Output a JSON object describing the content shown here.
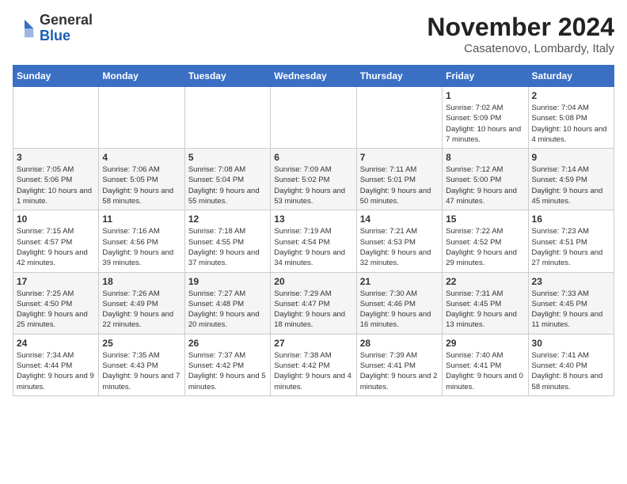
{
  "header": {
    "logo_general": "General",
    "logo_blue": "Blue",
    "month_title": "November 2024",
    "location": "Casatenovo, Lombardy, Italy"
  },
  "weekdays": [
    "Sunday",
    "Monday",
    "Tuesday",
    "Wednesday",
    "Thursday",
    "Friday",
    "Saturday"
  ],
  "weeks": [
    [
      {
        "day": "",
        "info": ""
      },
      {
        "day": "",
        "info": ""
      },
      {
        "day": "",
        "info": ""
      },
      {
        "day": "",
        "info": ""
      },
      {
        "day": "",
        "info": ""
      },
      {
        "day": "1",
        "info": "Sunrise: 7:02 AM\nSunset: 5:09 PM\nDaylight: 10 hours and 7 minutes."
      },
      {
        "day": "2",
        "info": "Sunrise: 7:04 AM\nSunset: 5:08 PM\nDaylight: 10 hours and 4 minutes."
      }
    ],
    [
      {
        "day": "3",
        "info": "Sunrise: 7:05 AM\nSunset: 5:06 PM\nDaylight: 10 hours and 1 minute."
      },
      {
        "day": "4",
        "info": "Sunrise: 7:06 AM\nSunset: 5:05 PM\nDaylight: 9 hours and 58 minutes."
      },
      {
        "day": "5",
        "info": "Sunrise: 7:08 AM\nSunset: 5:04 PM\nDaylight: 9 hours and 55 minutes."
      },
      {
        "day": "6",
        "info": "Sunrise: 7:09 AM\nSunset: 5:02 PM\nDaylight: 9 hours and 53 minutes."
      },
      {
        "day": "7",
        "info": "Sunrise: 7:11 AM\nSunset: 5:01 PM\nDaylight: 9 hours and 50 minutes."
      },
      {
        "day": "8",
        "info": "Sunrise: 7:12 AM\nSunset: 5:00 PM\nDaylight: 9 hours and 47 minutes."
      },
      {
        "day": "9",
        "info": "Sunrise: 7:14 AM\nSunset: 4:59 PM\nDaylight: 9 hours and 45 minutes."
      }
    ],
    [
      {
        "day": "10",
        "info": "Sunrise: 7:15 AM\nSunset: 4:57 PM\nDaylight: 9 hours and 42 minutes."
      },
      {
        "day": "11",
        "info": "Sunrise: 7:16 AM\nSunset: 4:56 PM\nDaylight: 9 hours and 39 minutes."
      },
      {
        "day": "12",
        "info": "Sunrise: 7:18 AM\nSunset: 4:55 PM\nDaylight: 9 hours and 37 minutes."
      },
      {
        "day": "13",
        "info": "Sunrise: 7:19 AM\nSunset: 4:54 PM\nDaylight: 9 hours and 34 minutes."
      },
      {
        "day": "14",
        "info": "Sunrise: 7:21 AM\nSunset: 4:53 PM\nDaylight: 9 hours and 32 minutes."
      },
      {
        "day": "15",
        "info": "Sunrise: 7:22 AM\nSunset: 4:52 PM\nDaylight: 9 hours and 29 minutes."
      },
      {
        "day": "16",
        "info": "Sunrise: 7:23 AM\nSunset: 4:51 PM\nDaylight: 9 hours and 27 minutes."
      }
    ],
    [
      {
        "day": "17",
        "info": "Sunrise: 7:25 AM\nSunset: 4:50 PM\nDaylight: 9 hours and 25 minutes."
      },
      {
        "day": "18",
        "info": "Sunrise: 7:26 AM\nSunset: 4:49 PM\nDaylight: 9 hours and 22 minutes."
      },
      {
        "day": "19",
        "info": "Sunrise: 7:27 AM\nSunset: 4:48 PM\nDaylight: 9 hours and 20 minutes."
      },
      {
        "day": "20",
        "info": "Sunrise: 7:29 AM\nSunset: 4:47 PM\nDaylight: 9 hours and 18 minutes."
      },
      {
        "day": "21",
        "info": "Sunrise: 7:30 AM\nSunset: 4:46 PM\nDaylight: 9 hours and 16 minutes."
      },
      {
        "day": "22",
        "info": "Sunrise: 7:31 AM\nSunset: 4:45 PM\nDaylight: 9 hours and 13 minutes."
      },
      {
        "day": "23",
        "info": "Sunrise: 7:33 AM\nSunset: 4:45 PM\nDaylight: 9 hours and 11 minutes."
      }
    ],
    [
      {
        "day": "24",
        "info": "Sunrise: 7:34 AM\nSunset: 4:44 PM\nDaylight: 9 hours and 9 minutes."
      },
      {
        "day": "25",
        "info": "Sunrise: 7:35 AM\nSunset: 4:43 PM\nDaylight: 9 hours and 7 minutes."
      },
      {
        "day": "26",
        "info": "Sunrise: 7:37 AM\nSunset: 4:42 PM\nDaylight: 9 hours and 5 minutes."
      },
      {
        "day": "27",
        "info": "Sunrise: 7:38 AM\nSunset: 4:42 PM\nDaylight: 9 hours and 4 minutes."
      },
      {
        "day": "28",
        "info": "Sunrise: 7:39 AM\nSunset: 4:41 PM\nDaylight: 9 hours and 2 minutes."
      },
      {
        "day": "29",
        "info": "Sunrise: 7:40 AM\nSunset: 4:41 PM\nDaylight: 9 hours and 0 minutes."
      },
      {
        "day": "30",
        "info": "Sunrise: 7:41 AM\nSunset: 4:40 PM\nDaylight: 8 hours and 58 minutes."
      }
    ]
  ]
}
